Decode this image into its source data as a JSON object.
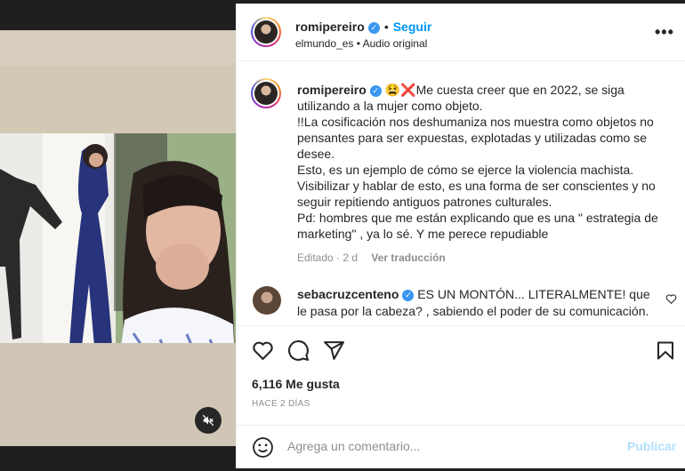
{
  "header": {
    "username": "romipereiro",
    "verified_glyph": "✓",
    "dot": "•",
    "follow_label": "Seguir",
    "source": "elmundo_es",
    "separator": "•",
    "audio": "Audio original",
    "more_label": "•••"
  },
  "caption": {
    "username": "romipereiro",
    "emojis": "😫❌",
    "lines": [
      "Me cuesta creer que en 2022, se siga utilizando a la mujer como objeto.",
      "!!La cosificación nos deshumaniza nos muestra como objetos no pensantes para ser expuestas, explotadas y utilizadas como se desee.",
      "Esto, es un ejemplo de cómo se ejerce la violencia machista.",
      "Visibilizar y hablar de esto, es una forma de ser conscientes y no seguir repitiendo antiguos patrones culturales.",
      "Pd: hombres que me están explicando que es una \" estrategia de marketing\" , ya lo sé. Y me perece repudiable"
    ],
    "edited": "Editado · 2 d",
    "translate_label": "Ver traducción"
  },
  "comment": {
    "username": "sebacruzcenteno",
    "text": "ES UN MONTÓN... LITERALMENTE! que le pasa por la cabeza? , sabiendo el poder de su comunicación."
  },
  "stats": {
    "likes": "6,116 Me gusta",
    "date": "HACE 2 DÍAS"
  },
  "add_comment": {
    "placeholder": "Agrega un comentario...",
    "publish_label": "Publicar"
  },
  "icons": {
    "like": "heart-icon",
    "comment": "comment-icon",
    "share": "share-icon",
    "save": "bookmark-icon",
    "emoji": "emoji-icon",
    "mute": "muted-speaker-icon"
  },
  "colors": {
    "accent": "#0095f6",
    "verified": "#3897f0",
    "muted_text": "#8e8e8e",
    "publish_disabled": "#b2dffc"
  }
}
